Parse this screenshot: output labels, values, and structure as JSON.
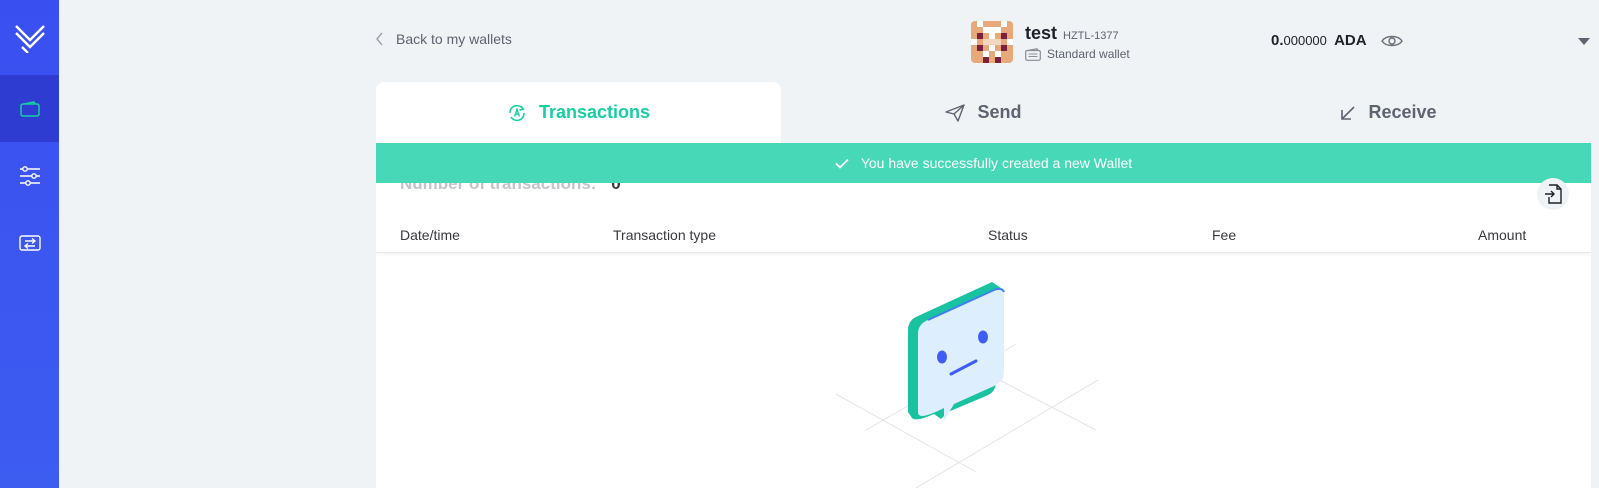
{
  "sidebar": {
    "logo_icon": "yoroi-logo-icon",
    "items": [
      {
        "icon": "wallet-icon",
        "active": true
      },
      {
        "icon": "settings-sliders-icon",
        "active": false
      },
      {
        "icon": "transfer-icon",
        "active": false
      }
    ]
  },
  "header": {
    "back_label": "Back to my wallets",
    "wallet_name": "test",
    "wallet_plate": "HZTL-1377",
    "wallet_type": "Standard wallet",
    "balance_int": "0.",
    "balance_dec": "000000",
    "currency": "ADA"
  },
  "tabs": [
    {
      "label": "Transactions",
      "icon": "transactions-icon",
      "active": true
    },
    {
      "label": "Send",
      "icon": "send-icon",
      "active": false
    },
    {
      "label": "Receive",
      "icon": "receive-icon",
      "active": false
    }
  ],
  "notice": {
    "text": "You have successfully created a new Wallet"
  },
  "transactions": {
    "count_label": "Number of transactions:",
    "count_value": "0",
    "columns": [
      "Date/time",
      "Transaction type",
      "Status",
      "Fee",
      "Amount"
    ]
  },
  "colors": {
    "sidebar": "#3a4ff0",
    "accent": "#17cfa4",
    "notice": "#47d8b8"
  }
}
